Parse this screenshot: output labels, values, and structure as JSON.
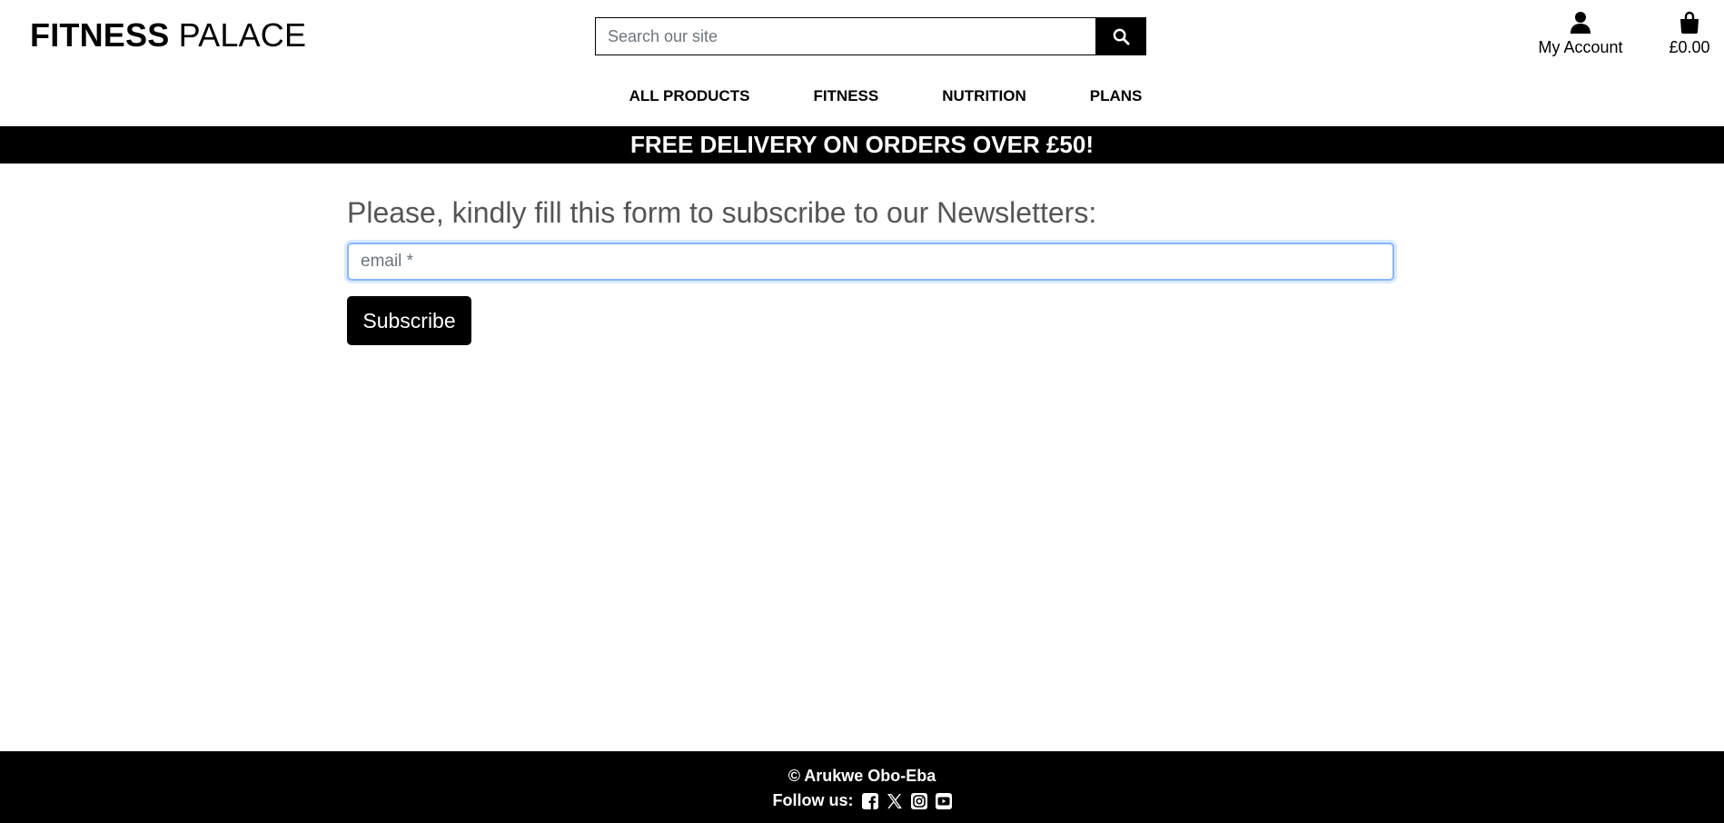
{
  "header": {
    "logo_strong": "FITNESS",
    "logo_light": "PALACE",
    "search_placeholder": "Search our site",
    "account_label": "My Account",
    "bag_total": "£0.00"
  },
  "nav": {
    "items": [
      "ALL PRODUCTS",
      "FITNESS",
      "NUTRITION",
      "PLANS"
    ]
  },
  "banner": {
    "text": "FREE DELIVERY ON ORDERS OVER £50!"
  },
  "form": {
    "title": "Please, kindly fill this form to subscribe to our Newsletters:",
    "email_placeholder": "email *",
    "email_value": "",
    "submit_label": "Subscribe"
  },
  "footer": {
    "copyright": "© Arukwe Obo-Eba",
    "follow_label": "Follow us:",
    "social_icons": [
      "facebook-square-icon",
      "x-twitter-icon",
      "instagram-square-icon",
      "youtube-square-icon"
    ]
  },
  "colors": {
    "primary": "#000000",
    "heading_text": "#555555",
    "focus_border": "#86b7fe",
    "background": "#ffffff"
  }
}
